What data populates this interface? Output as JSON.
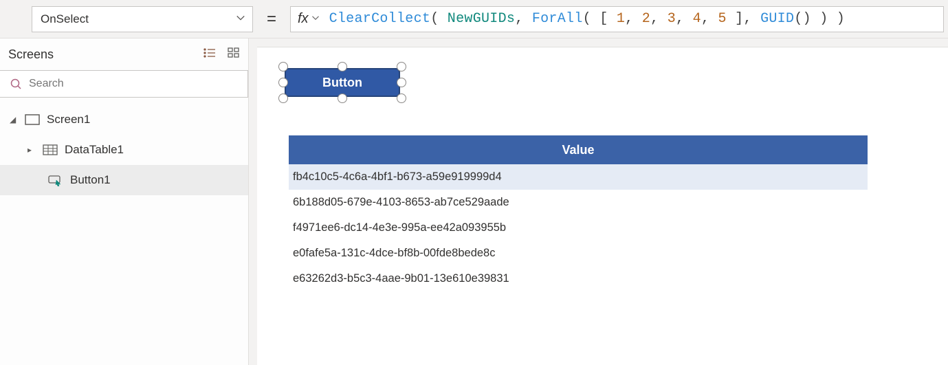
{
  "property_dropdown": {
    "value": "OnSelect"
  },
  "formula": {
    "fx": "fx",
    "t1": "ClearCollect",
    "p1": "( ",
    "t2": "NewGUIDs",
    "p2": ", ",
    "t3": "ForAll",
    "p3": "( [ ",
    "n1": "1",
    "c1": ", ",
    "n2": "2",
    "c2": ", ",
    "n3": "3",
    "c3": ", ",
    "n4": "4",
    "c4": ", ",
    "n5": "5",
    "p4": " ], ",
    "t4": "GUID",
    "p5": "() ) )"
  },
  "left": {
    "title": "Screens",
    "search_placeholder": "Search",
    "tree": {
      "screen": "Screen1",
      "datatable": "DataTable1",
      "button": "Button1"
    }
  },
  "canvas": {
    "button_text": "Button",
    "table": {
      "header": "Value",
      "rows": [
        "fb4c10c5-4c6a-4bf1-b673-a59e919999d4",
        "6b188d05-679e-4103-8653-ab7ce529aade",
        "f4971ee6-dc14-4e3e-995a-ee42a093955b",
        "e0fafe5a-131c-4dce-bf8b-00fde8bede8c",
        "e63262d3-b5c3-4aae-9b01-13e610e39831"
      ]
    }
  }
}
